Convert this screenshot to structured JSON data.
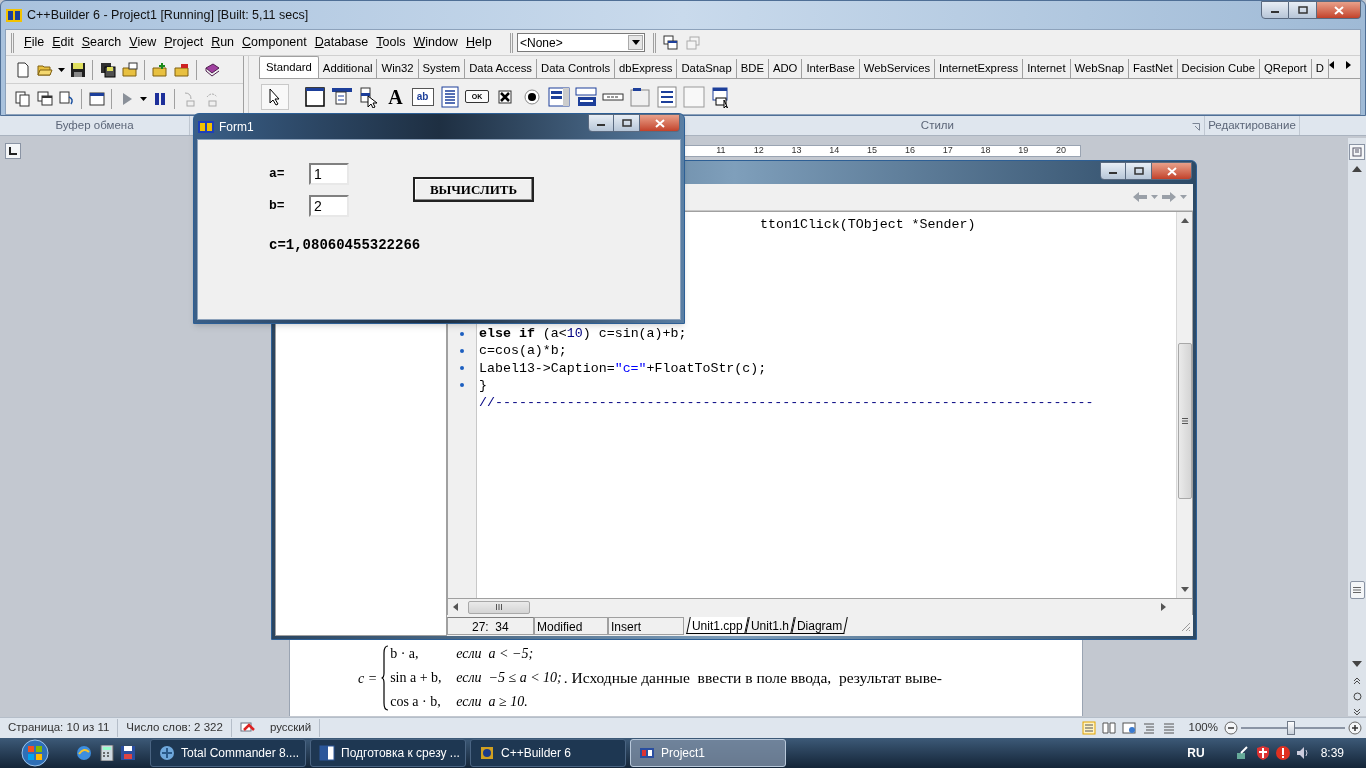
{
  "ide": {
    "window": {
      "title": "C++Builder 6 - Project1 [Running] [Built: 5,11 secs]"
    },
    "menu": [
      "File",
      "Edit",
      "Search",
      "View",
      "Project",
      "Run",
      "Component",
      "Database",
      "Tools",
      "Window",
      "Help"
    ],
    "project_combo": {
      "value": "<None>"
    },
    "palette": {
      "tabs": [
        {
          "label": "Standard",
          "selected": true
        },
        {
          "label": "Additional",
          "selected": false
        },
        {
          "label": "Win32",
          "selected": false
        },
        {
          "label": "System",
          "selected": false
        },
        {
          "label": "Data Access",
          "selected": false
        },
        {
          "label": "Data Controls",
          "selected": false
        },
        {
          "label": "dbExpress",
          "selected": false
        },
        {
          "label": "DataSnap",
          "selected": false
        },
        {
          "label": "BDE",
          "selected": false
        },
        {
          "label": "ADO",
          "selected": false
        },
        {
          "label": "InterBase",
          "selected": false
        },
        {
          "label": "WebServices",
          "selected": false
        },
        {
          "label": "InternetExpress",
          "selected": false
        },
        {
          "label": "Internet",
          "selected": false
        },
        {
          "label": "WebSnap",
          "selected": false
        },
        {
          "label": "FastNet",
          "selected": false
        },
        {
          "label": "Decision Cube",
          "selected": false
        },
        {
          "label": "QReport",
          "selected": false
        },
        {
          "label": "D",
          "selected": false
        }
      ],
      "components": [
        {
          "kind": "frame"
        },
        {
          "kind": "mainmenu"
        },
        {
          "kind": "popup"
        },
        {
          "kind": "label",
          "text": "A"
        },
        {
          "kind": "edit",
          "text": "ab"
        },
        {
          "kind": "memo"
        },
        {
          "kind": "button",
          "text": "OK"
        },
        {
          "kind": "checkbox"
        },
        {
          "kind": "radio"
        },
        {
          "kind": "listbox"
        },
        {
          "kind": "combobox"
        },
        {
          "kind": "scrollbar"
        },
        {
          "kind": "groupbox"
        },
        {
          "kind": "radiogroup"
        },
        {
          "kind": "panel"
        },
        {
          "kind": "actionlist"
        }
      ]
    }
  },
  "word": {
    "ribbon_groups": [
      "Буфер обмена",
      "Стили",
      "Редактирование"
    ],
    "ruler_numbers": [
      "11",
      "12",
      "13",
      "14",
      "15",
      "16",
      "17",
      "18",
      "19",
      "20"
    ],
    "document": {
      "lhs": "c =",
      "cases": [
        {
          "expr": "b · a,",
          "cond": "если  a < −5;"
        },
        {
          "expr": "sin a + b,",
          "cond": "если  −5 ≤ a < 10;"
        },
        {
          "expr": "cos a · b,",
          "cond": "если  a ≥ 10."
        }
      ],
      "sentence": ". Исходные данные  ввести в поле ввода,  результат выве-"
    },
    "status_bar": {
      "page": "Страница: 10 из 11",
      "words": "Число слов: 2 322",
      "language": "русский",
      "zoom": "100%",
      "zoom_slider": {
        "level": 0.5
      }
    }
  },
  "code_editor": {
    "lines": [
      {
        "kind": "partial",
        "dot": false,
        "segments": [
          {
            "kind": "plain",
            "text": "tton1Click(TObject *Sender)"
          }
        ]
      },
      {
        "kind": "code",
        "dot": true,
        "segments": [
          {
            "kind": "keyword",
            "text": "else if"
          },
          {
            "kind": "plain",
            "text": " (a<"
          },
          {
            "kind": "number",
            "text": "10"
          },
          {
            "kind": "plain",
            "text": ") c=sin(a)+b;"
          }
        ]
      },
      {
        "kind": "code",
        "dot": true,
        "segments": [
          {
            "kind": "plain",
            "text": "c=cos(a)*b;"
          }
        ]
      },
      {
        "kind": "code",
        "dot": true,
        "segments": [
          {
            "kind": "plain",
            "text": "Label13->Caption="
          },
          {
            "kind": "string",
            "text": "\"c=\""
          },
          {
            "kind": "plain",
            "text": "+FloatToStr(c);"
          }
        ]
      },
      {
        "kind": "code",
        "dot": true,
        "segments": [
          {
            "kind": "plain",
            "text": "}"
          }
        ]
      },
      {
        "kind": "code",
        "dot": false,
        "segments": [
          {
            "kind": "comment",
            "text": "//---------------------------------------------------------------------------"
          }
        ]
      }
    ],
    "status": {
      "position": "27:  34",
      "modified": "Modified",
      "mode": "Insert"
    },
    "tabs": [
      {
        "label": "Unit1.cpp",
        "selected": true
      },
      {
        "label": "Unit1.h",
        "selected": false
      },
      {
        "label": "Diagram",
        "selected": false
      }
    ]
  },
  "form1": {
    "window": {
      "title": "Form1"
    },
    "fields": [
      {
        "label": "a=",
        "value": "1"
      },
      {
        "label": "b=",
        "value": "2"
      }
    ],
    "button": "ВЫЧИСЛИТЬ",
    "result": "c=1,08060455322266"
  },
  "taskbar": {
    "buttons": [
      {
        "label": "Total Commander 8....",
        "selected": false
      },
      {
        "label": "Подготовка к срезу ...",
        "selected": false
      },
      {
        "label": "C++Builder 6",
        "selected": false
      },
      {
        "label": "Project1",
        "selected": true
      }
    ],
    "language": "RU",
    "clock": "8:39"
  }
}
